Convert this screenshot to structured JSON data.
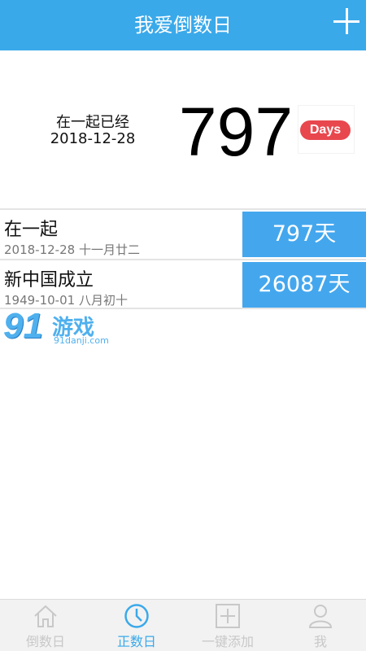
{
  "header": {
    "title": "我爱倒数日",
    "add_icon": "plus-icon"
  },
  "hero": {
    "label": "在一起已经",
    "date": "2018-12-28",
    "count": "797",
    "badge": "Days"
  },
  "events": [
    {
      "name": "在一起",
      "date_line": "2018-12-28  十一月廿二",
      "days": "797天"
    },
    {
      "name": "新中国成立",
      "date_line": "1949-10-01  八月初十",
      "days": "26087天"
    }
  ],
  "watermark": {
    "number": "91",
    "text": "游戏",
    "url": "91danji.com"
  },
  "tabbar": {
    "tabs": [
      {
        "label": "倒数日",
        "icon": "home-icon",
        "active": false
      },
      {
        "label": "正数日",
        "icon": "clock-icon",
        "active": true
      },
      {
        "label": "一键添加",
        "icon": "plus-box-icon",
        "active": false
      },
      {
        "label": "我",
        "icon": "user-icon",
        "active": false
      }
    ]
  },
  "colors": {
    "accent": "#3aa9ea",
    "days_bg": "#44a7ee",
    "badge": "#e8474e",
    "inactive": "#c8c8c8"
  }
}
